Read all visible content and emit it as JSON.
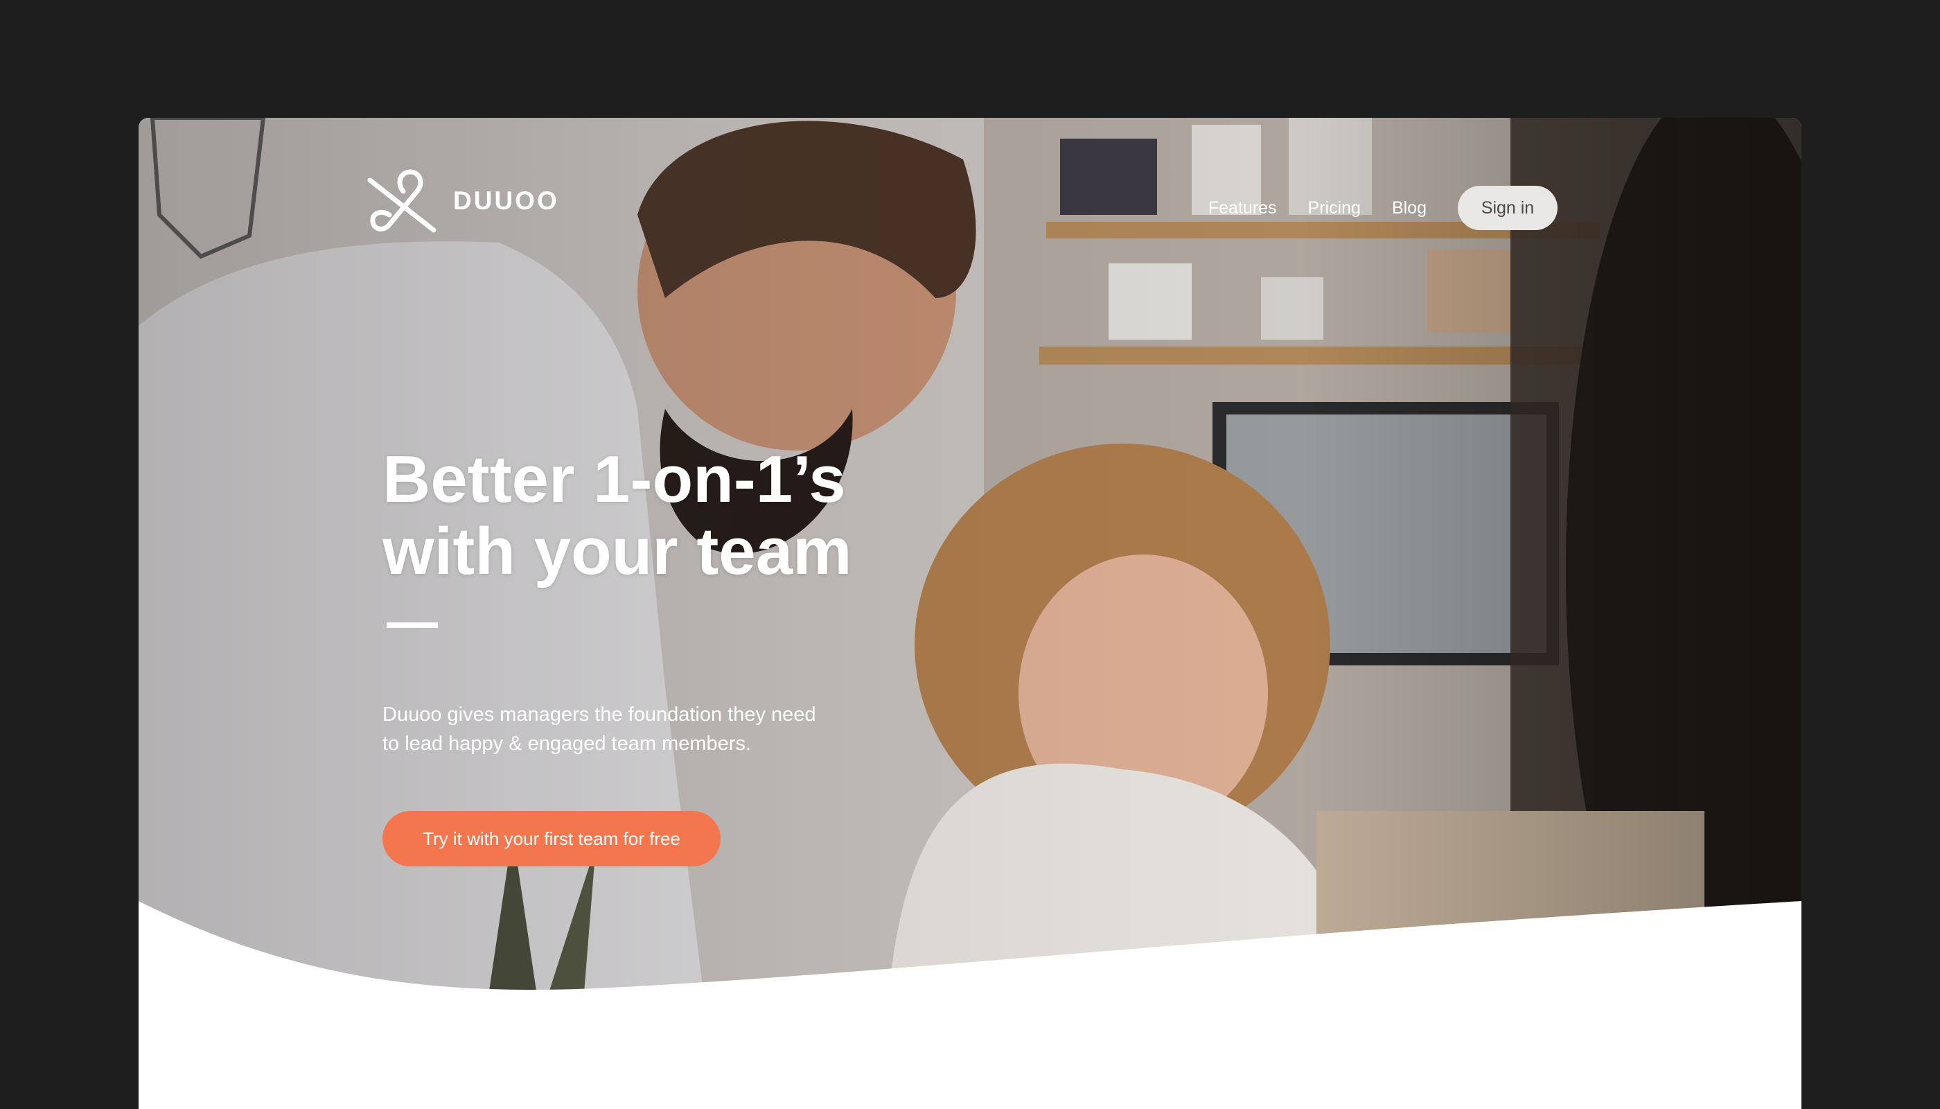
{
  "brand": {
    "name": "DUUOO",
    "logo_icon": "duuoo-knot-icon"
  },
  "nav": {
    "items": [
      {
        "label": "Features"
      },
      {
        "label": "Pricing"
      },
      {
        "label": "Blog"
      }
    ],
    "sign_in_label": "Sign in"
  },
  "hero": {
    "headline_line1": "Better 1-on-1’s",
    "headline_line2": "with your team",
    "subtitle_line1": "Duuoo gives managers the foundation they need",
    "subtitle_line2": "to lead happy & engaged team members.",
    "cta_label": "Try it with your first team for free"
  },
  "colors": {
    "outer_background": "#1e1e1e",
    "cta": "#f4764e",
    "sign_in_bg": "#e9e7e6",
    "page_background": "#ffffff"
  }
}
